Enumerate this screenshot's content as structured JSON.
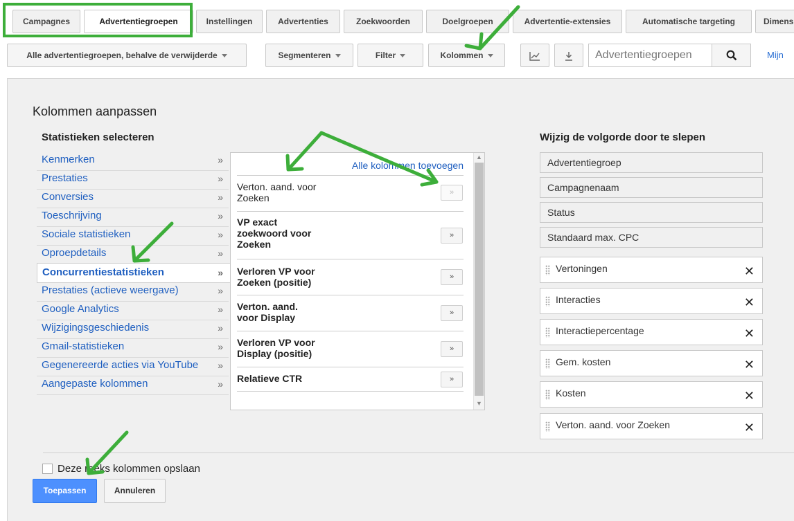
{
  "tabs": [
    "Campagnes",
    "Advertentiegroepen",
    "Instellingen",
    "Advertenties",
    "Zoekwoorden",
    "Doelgroepen",
    "Advertentie-extensies",
    "Automatische targeting",
    "Dimens"
  ],
  "toolbar": {
    "filter_scope": "Alle advertentiegroepen, behalve de verwijderde",
    "segment": "Segmenteren",
    "filter": "Filter",
    "columns": "Kolommen",
    "search_placeholder": "Advertentiegroepen",
    "mijn": "Mijn"
  },
  "panel": {
    "title": "Kolommen aanpassen",
    "select_title": "Statistieken selecteren",
    "order_title": "Wijzig de volgorde door te slepen",
    "add_all": "Alle kolommen toevoegen"
  },
  "categories": [
    "Kenmerken",
    "Prestaties",
    "Conversies",
    "Toeschrijving",
    "Sociale statistieken",
    "Oproepdetails",
    "Concurrentiestatistieken",
    "Prestaties (actieve weergave)",
    "Google Analytics",
    "Wijzigingsgeschiedenis",
    "Gmail-statistieken",
    "Gegenereerde acties via YouTube",
    "Aangepaste kolommen"
  ],
  "category_chevron": "»",
  "metrics": [
    {
      "l1": "Verton. aand. voor",
      "l2": "Zoeken",
      "l3": ""
    },
    {
      "l1": "VP exact",
      "l2": "zoekwoord voor",
      "l3": "Zoeken"
    },
    {
      "l1": "Verloren VP voor",
      "l2": "Zoeken (positie)",
      "l3": ""
    },
    {
      "l1": "Verton. aand.",
      "l2": "voor Display",
      "l3": ""
    },
    {
      "l1": "Verloren VP voor",
      "l2": "Display (positie)",
      "l3": ""
    },
    {
      "l1": "Relatieve CTR",
      "l2": "",
      "l3": ""
    }
  ],
  "add_symbol": "»",
  "fixed_columns": [
    "Advertentiegroep",
    "Campagnenaam",
    "Status",
    "Standaard max. CPC"
  ],
  "draggable_columns": [
    "Vertoningen",
    "Interacties",
    "Interactiepercentage",
    "Gem. kosten",
    "Kosten",
    "Verton. aand. voor Zoeken"
  ],
  "remove_symbol": "✕",
  "save_label": "Deze reeks kolommen opslaan",
  "apply": "Toepassen",
  "cancel": "Annuleren",
  "annotation_color": "#3dae3a",
  "link_color": "#1f5fc0",
  "primary_color": "#4d90fe"
}
